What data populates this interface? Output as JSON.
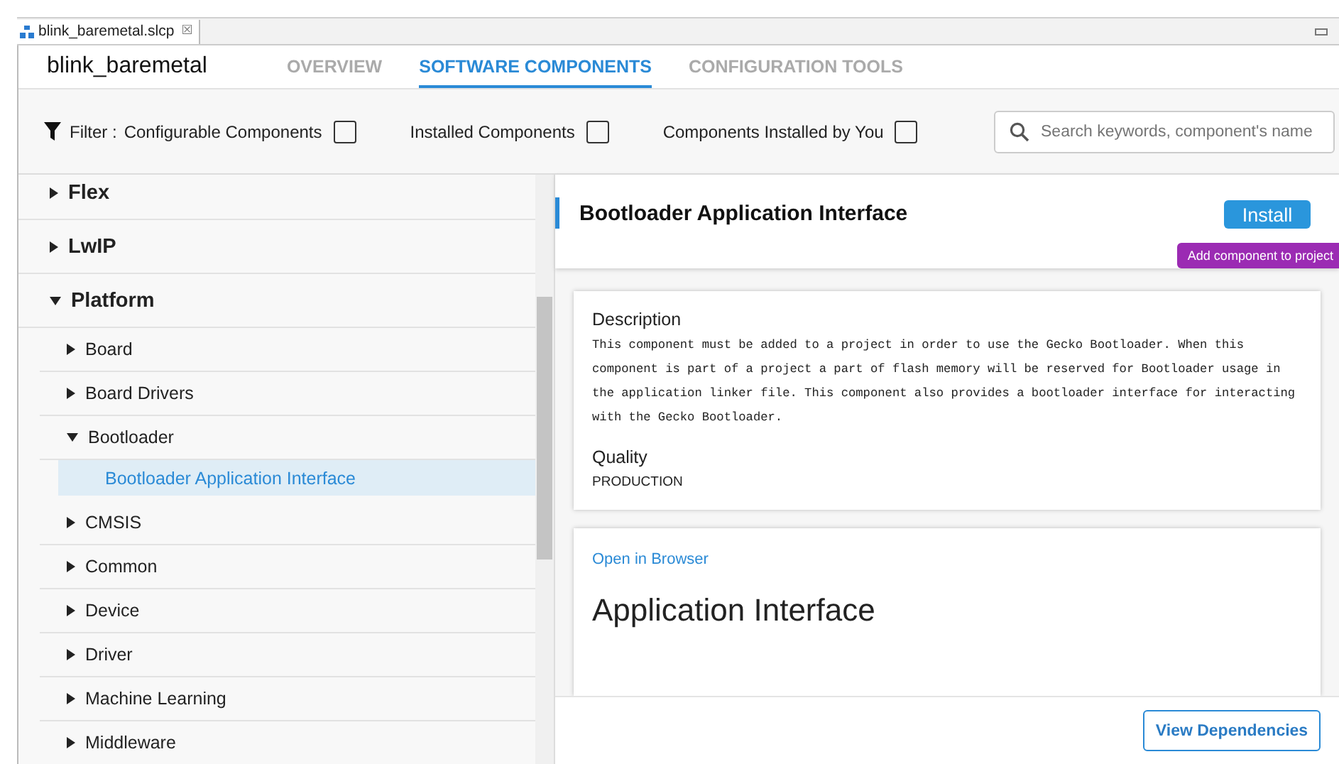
{
  "editor_tab": {
    "title": "blink_baremetal.slcp",
    "close": "☒"
  },
  "header": {
    "project": "blink_baremetal",
    "tabs": [
      {
        "label": "OVERVIEW",
        "selected": false
      },
      {
        "label": "SOFTWARE COMPONENTS",
        "selected": true
      },
      {
        "label": "CONFIGURATION TOOLS",
        "selected": false
      }
    ]
  },
  "filter": {
    "label": "Filter :",
    "options": [
      {
        "label": "Configurable Components",
        "checked": false
      },
      {
        "label": "Installed Components",
        "checked": false
      },
      {
        "label": "Components Installed by You",
        "checked": false
      }
    ],
    "search": {
      "placeholder": "Search keywords, component's name"
    }
  },
  "tree": [
    {
      "label": "Flex",
      "expanded": false
    },
    {
      "label": "LwIP",
      "expanded": false
    },
    {
      "label": "Platform",
      "expanded": true,
      "children": [
        {
          "label": "Board",
          "expanded": false
        },
        {
          "label": "Board Drivers",
          "expanded": false
        },
        {
          "label": "Bootloader",
          "expanded": true,
          "children": [
            {
              "label": "Bootloader Application Interface",
              "selected": true
            }
          ]
        },
        {
          "label": "CMSIS",
          "expanded": false
        },
        {
          "label": "Common",
          "expanded": false
        },
        {
          "label": "Device",
          "expanded": false
        },
        {
          "label": "Driver",
          "expanded": false
        },
        {
          "label": "Machine Learning",
          "expanded": false
        },
        {
          "label": "Middleware",
          "expanded": false
        }
      ]
    }
  ],
  "detail": {
    "title": "Bootloader Application Interface",
    "install_button": "Install",
    "tooltip": "Add component to project",
    "description_heading": "Description",
    "description": "This component must be added to a project in order to use the Gecko Bootloader. When this component is part of a project a part of flash memory will be reserved for Bootloader usage in the application linker file. This component also provides a bootloader interface for interacting with the Gecko Bootloader.",
    "quality_heading": "Quality",
    "quality": "PRODUCTION",
    "docs_link": "Open in Browser",
    "docs_heading": "Application Interface",
    "dependencies_button": "View Dependencies"
  }
}
